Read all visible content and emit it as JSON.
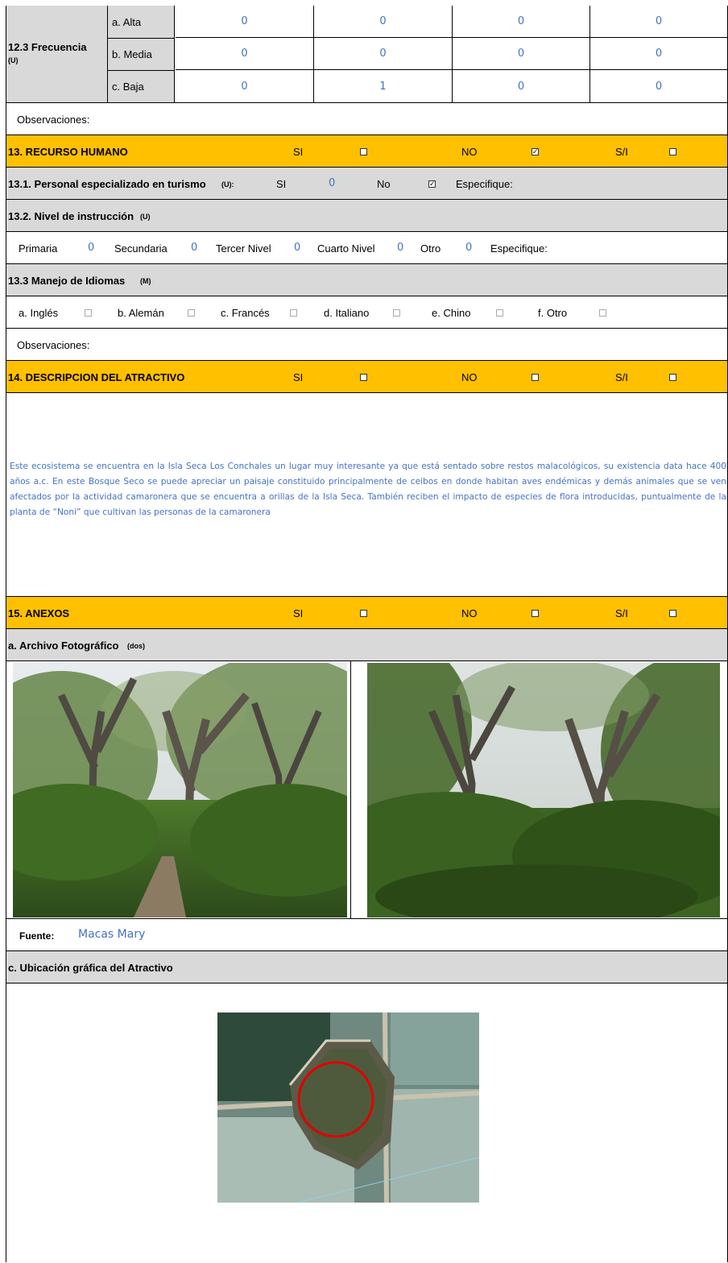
{
  "frequency": {
    "title": "12.3 Frecuencia",
    "qualifier": "(U)",
    "rows": [
      {
        "label": "a. Alta",
        "values": [
          "0",
          "0",
          "0",
          "0"
        ]
      },
      {
        "label": "b. Media",
        "values": [
          "0",
          "0",
          "0",
          "0"
        ]
      },
      {
        "label": "c. Baja",
        "values": [
          "0",
          "1",
          "0",
          "0"
        ]
      }
    ]
  },
  "observations_label": "Observaciones:",
  "section13": {
    "title": "13. RECURSO HUMANO",
    "si": "SI",
    "no": "NO",
    "si_checked": false,
    "no_checked": true,
    "sn": "S/I",
    "sn_checked": false
  },
  "staff": {
    "label": "13.1. Personal especializado en turismo",
    "qualifier": "(U):",
    "si": "SI",
    "si_value": "0",
    "no": "No",
    "no_checked": true,
    "specify": "Especifique:"
  },
  "education": {
    "label": "13.2. Nivel de instrucción",
    "qualifier": "(U)",
    "items": [
      {
        "label": "Primaria",
        "value": "0"
      },
      {
        "label": "Secundaria",
        "value": "0"
      },
      {
        "label": "Tercer Nivel",
        "value": "0"
      },
      {
        "label": "Cuarto Nivel",
        "value": "0"
      },
      {
        "label": "Otro",
        "value": "0"
      }
    ],
    "specify": "Especifique:"
  },
  "languages": {
    "label": "13.3 Manejo de Idiomas",
    "qualifier": "(M)",
    "items": [
      "a. Inglés",
      "b. Alemán",
      "c. Francés",
      "d. Italiano",
      "e. Chino",
      "f. Otro"
    ]
  },
  "section14": {
    "title": "14. DESCRIPCION DEL ATRACTIVO",
    "si": "SI",
    "no": "NO",
    "sn": "S/I",
    "description": "Este ecosistema se encuentra en la Isla Seca Los Conchales un lugar muy interesante ya que está sentado sobre restos malacológicos, su existencia data hace 400 años a.c. En este Bosque Seco se puede apreciar un paisaje constituido principalmente de ceibos en donde habitan aves endémicas y demás animales que se ven afectados por la actividad camaronera que se encuentra a orillas de la Isla Seca. También reciben el impacto de especies de flora introducidas, puntualmente de la planta de “Noni” que cultivan las personas de la camaronera"
  },
  "section15": {
    "title": "15. ANEXOS",
    "si": "SI",
    "no": "NO",
    "sn": "S/I"
  },
  "photos": {
    "label": "a. Archivo Fotográfico",
    "qualifier": "(dos)",
    "source_label": "Fuente:",
    "source_value": "Macas Mary"
  },
  "location": {
    "label": "c. Ubicación gráfica del Atractivo"
  },
  "colors": {
    "orange_band": "#ffc000",
    "gray_band": "#d9d9d9",
    "value_blue": "#4472c4",
    "map_marker": "#e00000"
  }
}
